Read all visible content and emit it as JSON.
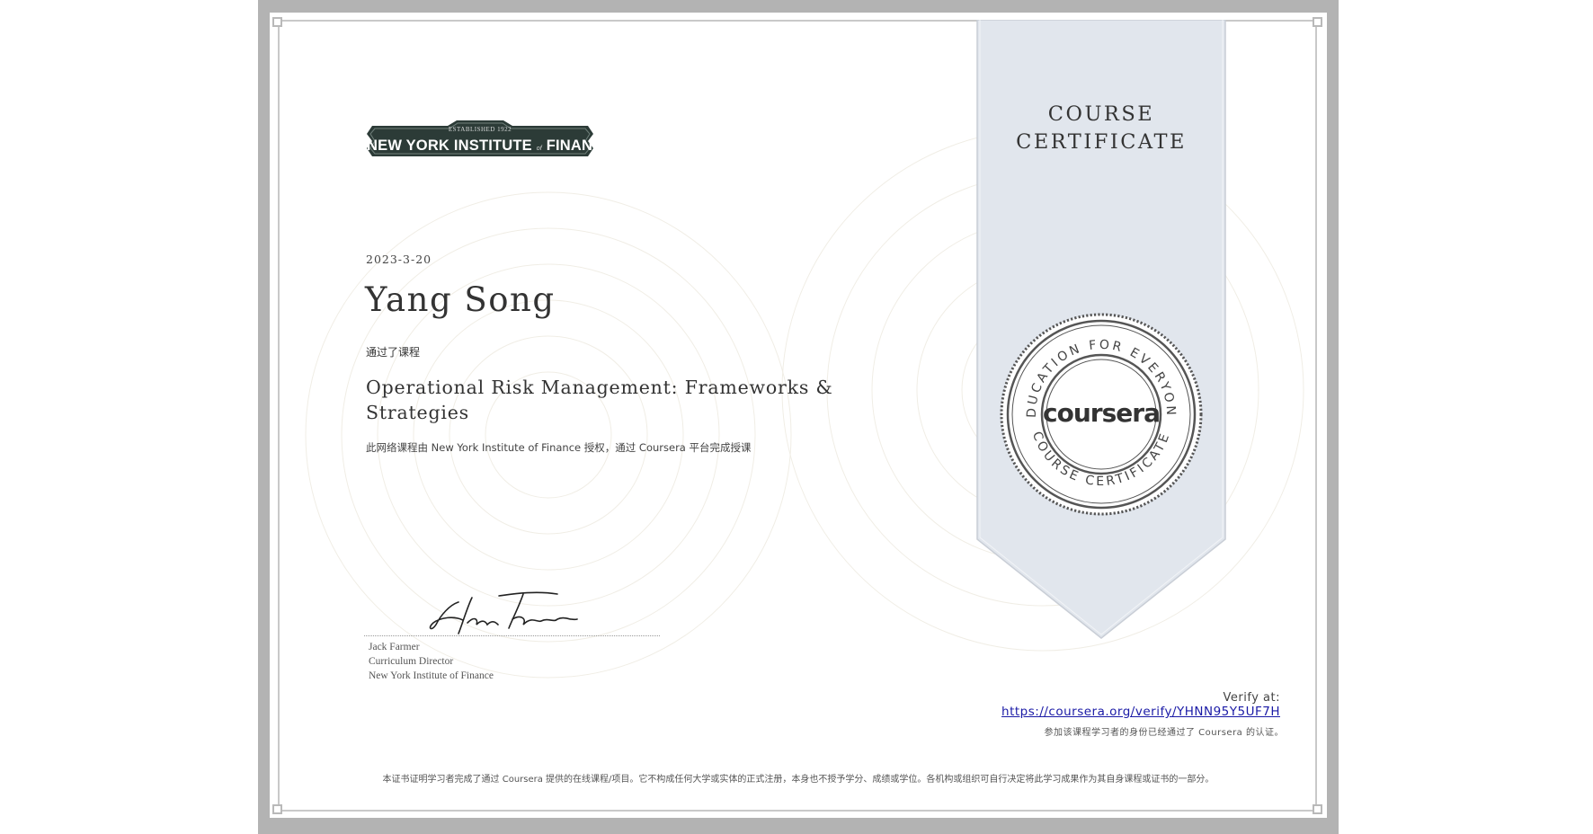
{
  "institution": {
    "logo_established": "ESTABLISHED 1922",
    "logo_name_part1": "NEW YORK INSTITUTE",
    "logo_name_of": "of",
    "logo_name_part2": "FINANCE"
  },
  "certificate": {
    "date": "2023-3-20",
    "recipient": "Yang Song",
    "completed_label": "通过了课程",
    "course_title": "Operational Risk Management: Frameworks & Strategies",
    "authorization": "此网络课程由 New York Institute of Finance 授权，通过 Coursera 平台完成授课"
  },
  "signature": {
    "signature_text": "Jack Farmer",
    "name": "Jack Farmer",
    "role": "Curriculum Director",
    "organization": "New York Institute of Finance"
  },
  "ribbon": {
    "title_line1": "COURSE",
    "title_line2": "CERTIFICATE",
    "seal_top_text": "EDUCATION FOR EVERYONE",
    "seal_bottom_text": "COURSE CERTIFICATE",
    "seal_wordmark": "coursera"
  },
  "verification": {
    "label": "Verify at:",
    "url": "https://coursera.org/verify/YHNN95Y5UF7H",
    "note": "参加该课程学习者的身份已经通过了 Coursera 的认证。"
  },
  "disclaimer": "本证书证明学习者完成了通过 Coursera 提供的在线课程/项目。它不构成任何大学或实体的正式注册，本身也不授予学分、成绩或学位。各机构或组织可自行决定将此学习成果作为其自身课程或证书的一部分。",
  "colors": {
    "frame": "#b3b3b3",
    "ribbon": "#e1e6ed",
    "logo_bg": "#2c3b37",
    "link": "#1a1aa6"
  }
}
